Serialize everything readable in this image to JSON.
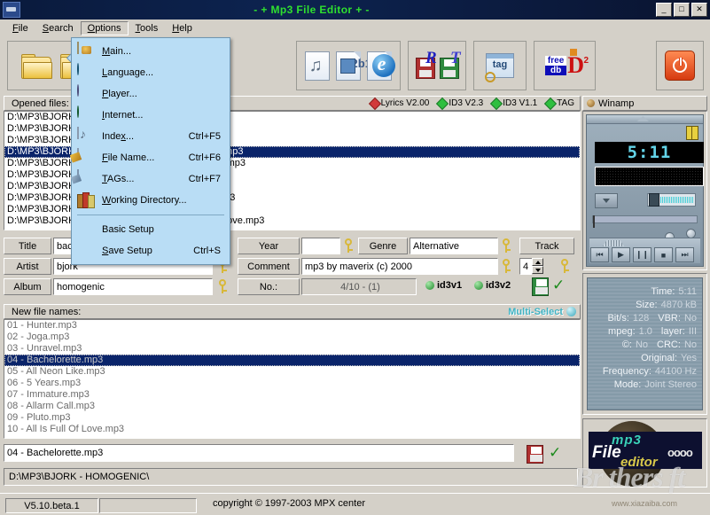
{
  "window": {
    "title": "- + Mp3 File Editor + -",
    "buttons": {
      "minimize": "_",
      "maximize": "□",
      "close": "✕"
    }
  },
  "menubar": {
    "items": [
      {
        "label": "File",
        "accel": "F"
      },
      {
        "label": "Search",
        "accel": "S"
      },
      {
        "label": "Options",
        "accel": "O"
      },
      {
        "label": "Tools",
        "accel": "T"
      },
      {
        "label": "Help",
        "accel": "H"
      }
    ]
  },
  "options_menu": {
    "open": true,
    "items": [
      {
        "label": "Main...",
        "shortcut": "",
        "icon": "window-icon"
      },
      {
        "label": "Language...",
        "shortcut": "",
        "icon": "globe-icon"
      },
      {
        "label": "Player...",
        "shortcut": "",
        "icon": "cd-sphere-icon"
      },
      {
        "label": "Internet...",
        "shortcut": "",
        "icon": "earth-icon"
      },
      {
        "label": "Index...",
        "shortcut": "Ctrl+F5",
        "icon": "music-note-page-icon"
      },
      {
        "label": "File Name...",
        "shortcut": "Ctrl+F6",
        "icon": "document-pencil-icon"
      },
      {
        "label": "TAGs...",
        "shortcut": "Ctrl+F7",
        "icon": "tag-document-icon"
      },
      {
        "label": "Working Directory...",
        "shortcut": "",
        "icon": "books-icon"
      }
    ],
    "footer_items": [
      {
        "label": "Basic Setup",
        "shortcut": ""
      },
      {
        "label": "Save Setup",
        "shortcut": "Ctrl+S"
      }
    ]
  },
  "toolbar": {
    "groups": [
      {
        "name": "file-group",
        "icons": [
          "open-folder-icon",
          "open-folder-diamond-icon"
        ]
      },
      {
        "name": "edit-group",
        "icons": [
          "folder-small-icon",
          "media-player-save-icon"
        ]
      },
      {
        "name": "export-group",
        "icons": [
          "music-page-icon",
          "tag-page-icon",
          "internet-explorer-icon"
        ]
      },
      {
        "name": "rename-group",
        "icons": [
          "floppy-red-R-icon",
          "floppy-green-T-icon"
        ]
      },
      {
        "name": "tag-search-group",
        "icons": [
          "tag-magnifier-icon"
        ]
      },
      {
        "name": "freedb-group",
        "icons": [
          "freedb-icon"
        ]
      },
      {
        "name": "exit-group",
        "icons": [
          "power-icon"
        ]
      }
    ],
    "freedb": {
      "line1": "free",
      "line2": "db",
      "mark": "D",
      "sup": "2"
    },
    "tag_icon_text": "tag"
  },
  "opened_files": {
    "header": "Opened files:",
    "flags": [
      {
        "label": "Lyrics V2.00",
        "color": "#d23a3a"
      },
      {
        "label": "ID3 V2.3",
        "color": "#2fbf3f"
      },
      {
        "label": "ID3 V1.1",
        "color": "#2fbf3f"
      },
      {
        "label": "TAG",
        "color": "#2fbf3f"
      }
    ],
    "rows": [
      {
        "text": "D:\\MP3\\BJORK - HOMOGENIC\\01 - Hunter.mp3",
        "selected": false
      },
      {
        "text": "D:\\MP3\\BJORK - HOMOGENIC\\02 - Joga.mp3",
        "selected": false
      },
      {
        "text": "D:\\MP3\\BJORK - HOMOGENIC\\03 - Unravel.mp3",
        "selected": false
      },
      {
        "text": "D:\\MP3\\BJORK - HOMOGENIC\\04 - Bachelorette.mp3",
        "selected": true
      },
      {
        "text": "D:\\MP3\\BJORK - HOMOGENIC\\05 - All Neon Like.mp3",
        "selected": false
      },
      {
        "text": "D:\\MP3\\BJORK - HOMOGENIC\\06 - 5 Years.mp3",
        "selected": false
      },
      {
        "text": "D:\\MP3\\BJORK - HOMOGENIC\\07 - Immature.mp3",
        "selected": false
      },
      {
        "text": "D:\\MP3\\BJORK - HOMOGENIC\\08 - Allarm Call.mp3",
        "selected": false
      },
      {
        "text": "D:\\MP3\\BJORK - HOMOGENIC\\09 - Pluto.mp3",
        "selected": false
      },
      {
        "text": "D:\\MP3\\BJORK - HOMOGENIC\\10 - All Is Full Of Love.mp3",
        "selected": false
      }
    ]
  },
  "tag_editor": {
    "title_label": "Title",
    "title_value": "bachelorette",
    "artist_label": "Artist",
    "artist_value": "bjork",
    "album_label": "Album",
    "album_value": "homogenic",
    "year_label": "Year",
    "year_value": "",
    "genre_label": "Genre",
    "genre_value": "Alternative",
    "track_label": "Track",
    "track_value": "4",
    "comment_label": "Comment",
    "comment_value": "mp3 by maverix (c) 2000",
    "no_label": "No.:",
    "no_value": "4/10 - (1)",
    "id3v1_label": "id3v1",
    "id3v2_label": "id3v2"
  },
  "new_file_names": {
    "header": "New file names:",
    "multi_select_label": "Multi-Select",
    "rows": [
      {
        "text": "01 - Hunter.mp3",
        "selected": false
      },
      {
        "text": "02 - Joga.mp3",
        "selected": false
      },
      {
        "text": "03 - Unravel.mp3",
        "selected": false
      },
      {
        "text": "04 - Bachelorette.mp3",
        "selected": true
      },
      {
        "text": "05 - All Neon Like.mp3",
        "selected": false
      },
      {
        "text": "06 - 5 Years.mp3",
        "selected": false
      },
      {
        "text": "07 - Immature.mp3",
        "selected": false
      },
      {
        "text": "08 - Allarm Call.mp3",
        "selected": false
      },
      {
        "text": "09 - Pluto.mp3",
        "selected": false
      },
      {
        "text": "10 - All Is Full Of Love.mp3",
        "selected": false
      }
    ]
  },
  "filename_field": {
    "value": "04 - Bachelorette.mp3"
  },
  "path_bar": {
    "value": "D:\\MP3\\BJORK - HOMOGENIC\\"
  },
  "statusbar": {
    "version": "V5.10.beta.1",
    "progress": "",
    "copyright": "copyright © 1997-2003  MPX center"
  },
  "winamp": {
    "header": "Winamp",
    "time_display": "5:11"
  },
  "file_info": {
    "rows": [
      {
        "key": "Time:",
        "value": "5:11",
        "key2": "",
        "value2": ""
      },
      {
        "key": "Size:",
        "value": "4870 kB",
        "key2": "",
        "value2": ""
      },
      {
        "key": "Bit/s:",
        "value": "128",
        "key2": "VBR:",
        "value2": "No"
      },
      {
        "key": "mpeg:",
        "value": "1.0",
        "key2": "layer:",
        "value2": "III"
      },
      {
        "key": "©:",
        "value": "No",
        "key2": "CRC:",
        "value2": "No"
      },
      {
        "key": "Original:",
        "value": "Yes",
        "key2": "",
        "value2": ""
      },
      {
        "key": "Frequency:",
        "value": "44100 Hz",
        "key2": "",
        "value2": ""
      },
      {
        "key": "Mode:",
        "value": "Joint Stereo",
        "key2": "",
        "value2": ""
      }
    ]
  },
  "logo": {
    "mp3": "mp3",
    "file": "File",
    "editor": "editor",
    "dots": "oooo"
  },
  "watermark": {
    "brand": "Br thers ft",
    "url": "www.xiazaiba.com"
  },
  "colors": {
    "title_text": "#2fe02f",
    "selection": "#0a246a",
    "menu_bg": "#b9ddf5",
    "window_bg": "#d4d0c8"
  }
}
